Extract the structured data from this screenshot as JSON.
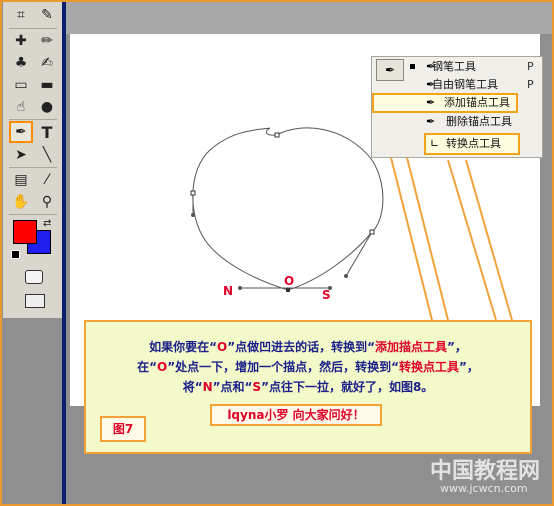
{
  "menu": {
    "items": [
      {
        "icon": "pen-icon",
        "label": "钢笔工具",
        "key": "P"
      },
      {
        "icon": "freeform-pen-icon",
        "label": "自由钢笔工具",
        "key": "P"
      },
      {
        "icon": "add-anchor-icon",
        "label": "添加锚点工具",
        "key": ""
      },
      {
        "icon": "delete-anchor-icon",
        "label": "删除锚点工具",
        "key": ""
      },
      {
        "icon": "convert-point-icon",
        "label": "转换点工具",
        "key": ""
      }
    ]
  },
  "points": {
    "n": "N",
    "o": "O",
    "s": "S"
  },
  "note": {
    "line1a": "如果你要在“",
    "line1b": "O",
    "line1c": "”点做凹进去的话，转换到“",
    "line1d": "添加描点工具",
    "line1e": "”，",
    "line2a": "在“",
    "line2b": "O",
    "line2c": "”处点一下，增加一个描点，然后，转换到“",
    "line2d": "转换点工具",
    "line2e": "”，",
    "line3a": "将“",
    "line3b": "N",
    "line3c": "”点和“",
    "line3d": "S",
    "line3e": "”点往下一拉，就好了，如图8。",
    "greeting": "lqyna小罗 向大家问好！",
    "figure_label": "图7"
  },
  "watermark": {
    "title": "中国教程网",
    "url": "www.jcwcn.com"
  },
  "colors": {
    "foreground": "#ff0000",
    "background": "#1f1ff0",
    "accent": "#f1a33a"
  }
}
